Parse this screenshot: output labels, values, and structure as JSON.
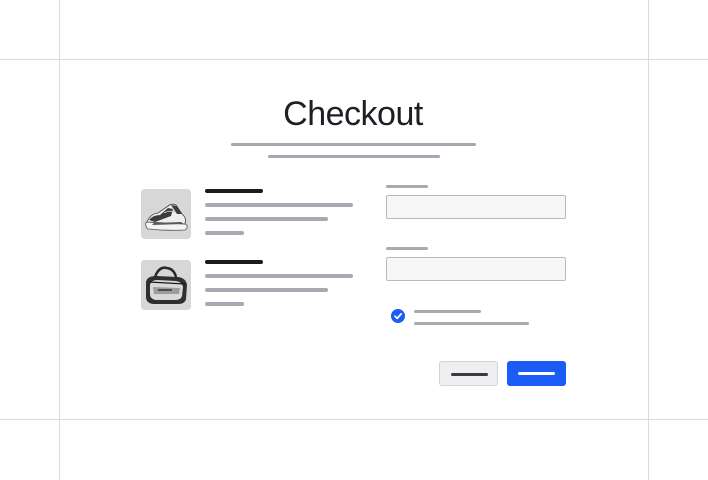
{
  "page": {
    "title": "Checkout"
  },
  "cart": {
    "items": [
      {
        "image": "sneaker-photo"
      },
      {
        "image": "duffel-bag-photo"
      }
    ]
  },
  "form": {
    "fields": [
      {
        "value": ""
      },
      {
        "value": ""
      }
    ],
    "checkbox": {
      "checked": true
    }
  },
  "colors": {
    "accent": "#1a5cf5",
    "text": "#1e1e24",
    "placeholder_bar": "#a9a9b2",
    "guide_line": "#d9d9de"
  }
}
